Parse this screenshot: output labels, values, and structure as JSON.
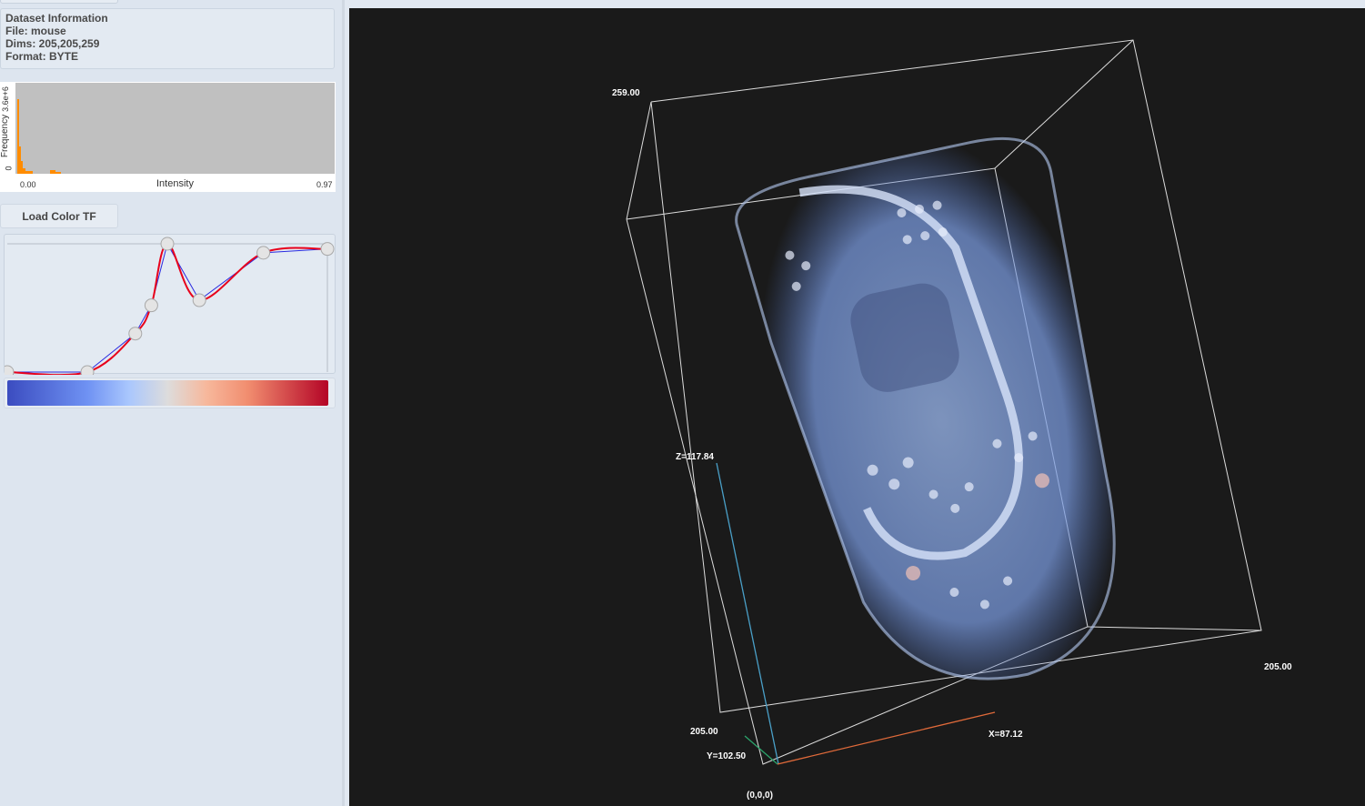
{
  "dataset_info": {
    "heading": "Dataset Information",
    "file": "File: mouse",
    "dims": "Dims: 205,205,259",
    "format": "Format: BYTE"
  },
  "histogram": {
    "y_label": "Frequency",
    "y_top_tick": "3.6e+6",
    "y_zero_tick": "0",
    "x_label": "Intensity",
    "x_min": "0.00",
    "x_max": "0.97",
    "bar_color": "#ff8c00"
  },
  "buttons": {
    "load_color_tf": "Load Color TF"
  },
  "transfer_function": {
    "curve_color": "#e8001b",
    "control_line_color": "#2a2ae0",
    "points": [
      {
        "x": 0.0,
        "y": 0.0
      },
      {
        "x": 0.25,
        "y": 0.0
      },
      {
        "x": 0.4,
        "y": 0.3
      },
      {
        "x": 0.45,
        "y": 0.52
      },
      {
        "x": 0.5,
        "y": 1.0
      },
      {
        "x": 0.6,
        "y": 0.56
      },
      {
        "x": 0.8,
        "y": 0.93
      },
      {
        "x": 1.0,
        "y": 0.96
      }
    ]
  },
  "colormap": {
    "name": "coolwarm",
    "colors": [
      "#3b4cc0",
      "#dddcdc",
      "#b40426"
    ]
  },
  "viewport": {
    "background": "#1a1a1a",
    "labels": {
      "top": "259.00",
      "z_axis": "Z=117.84",
      "y_far": "205.00",
      "y_axis": "Y=102.50",
      "x_axis": "X=87.12",
      "x_far": "205.00",
      "origin": "(0,0,0)"
    }
  }
}
